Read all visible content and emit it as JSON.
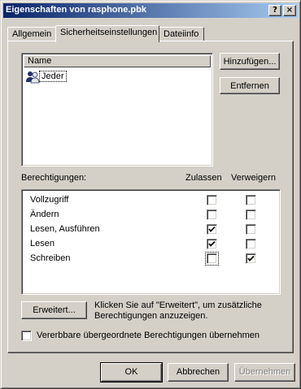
{
  "window": {
    "title": "Eigenschaften von rasphone.pbk",
    "help_glyph": "?",
    "close_glyph": "×"
  },
  "tabs": [
    {
      "label": "Allgemein",
      "active": false
    },
    {
      "label": "Sicherheitseinstellungen",
      "active": true
    },
    {
      "label": "Dateiinfo",
      "active": false
    }
  ],
  "users": {
    "column_header": "Name",
    "items": [
      {
        "label": "Jeder",
        "icon": "group-users-icon",
        "selected": true
      }
    ],
    "add_label": "Hinzufügen...",
    "remove_label": "Entfernen"
  },
  "permissions": {
    "label": "Berechtigungen:",
    "allow_header": "Zulassen",
    "deny_header": "Verweigern",
    "rows": [
      {
        "name": "Vollzugriff",
        "allow": false,
        "deny": false
      },
      {
        "name": "Ändern",
        "allow": false,
        "deny": false
      },
      {
        "name": "Lesen, Ausführen",
        "allow": true,
        "deny": false
      },
      {
        "name": "Lesen",
        "allow": true,
        "deny": false
      },
      {
        "name": "Schreiben",
        "allow": false,
        "deny": true
      }
    ]
  },
  "advanced": {
    "button_label": "Erweitert...",
    "description": "Klicken Sie auf \"Erweitert\", um zusätzliche Berechtigungen anzuzeigen."
  },
  "inherit": {
    "label": "Vererbbare übergeordnete Berechtigungen übernehmen",
    "checked": false
  },
  "footer": {
    "ok_label": "OK",
    "cancel_label": "Abbrechen",
    "apply_label": "Übernehmen"
  }
}
